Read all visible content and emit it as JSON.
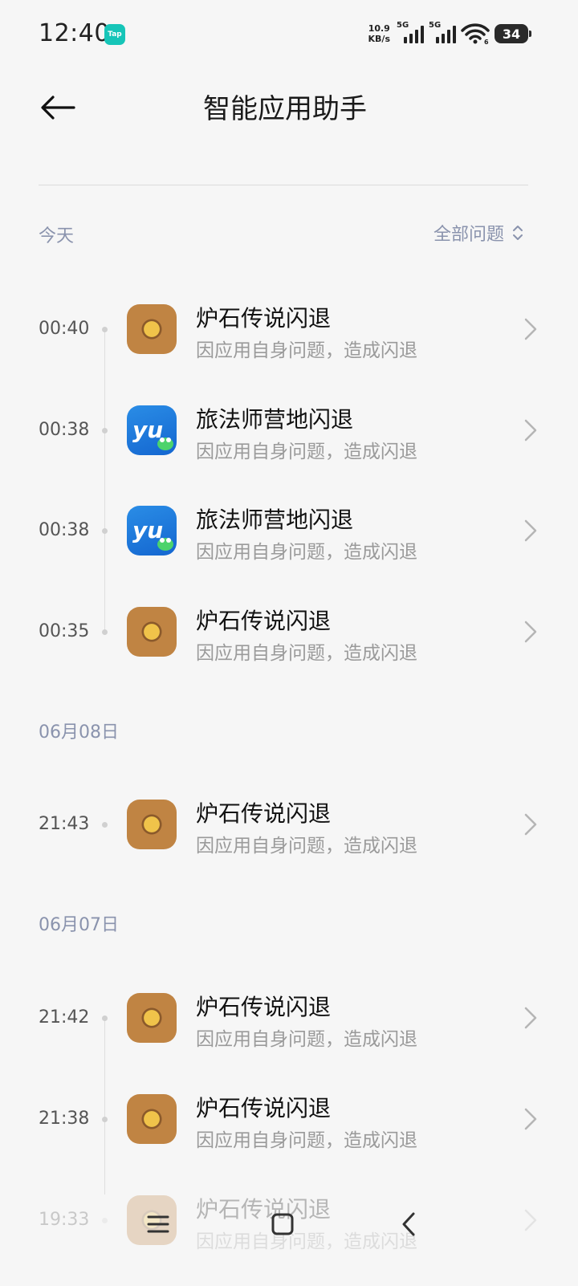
{
  "status_bar": {
    "time": "12:40",
    "tap_badge": "Tap",
    "net_speed_value": "10.9",
    "net_speed_unit": "KB/s",
    "sim1_label": "5G",
    "sim2_label": "5G",
    "wifi_label": "6",
    "battery": "34"
  },
  "header": {
    "title": "智能应用助手"
  },
  "filter": {
    "today_label": "今天",
    "all_issues_label": "全部问题"
  },
  "sections": [
    {
      "label": "今天",
      "items": [
        {
          "time": "00:40",
          "name": "炉石传说闪退",
          "reason": "因应用自身问题，造成闪退",
          "icon": "hearthstone-icon"
        },
        {
          "time": "00:38",
          "name": "旅法师营地闪退",
          "reason": "因应用自身问题，造成闪退",
          "icon": "yu-camp-icon"
        },
        {
          "time": "00:38",
          "name": "旅法师营地闪退",
          "reason": "因应用自身问题，造成闪退",
          "icon": "yu-camp-icon"
        },
        {
          "time": "00:35",
          "name": "炉石传说闪退",
          "reason": "因应用自身问题，造成闪退",
          "icon": "hearthstone-icon"
        }
      ]
    },
    {
      "label": "06月08日",
      "items": [
        {
          "time": "21:43",
          "name": "炉石传说闪退",
          "reason": "因应用自身问题，造成闪退",
          "icon": "hearthstone-icon"
        }
      ]
    },
    {
      "label": "06月07日",
      "items": [
        {
          "time": "21:42",
          "name": "炉石传说闪退",
          "reason": "因应用自身问题，造成闪退",
          "icon": "hearthstone-icon"
        },
        {
          "time": "21:38",
          "name": "炉石传说闪退",
          "reason": "因应用自身问题，造成闪退",
          "icon": "hearthstone-icon"
        },
        {
          "time": "19:33",
          "name": "炉石传说闪退",
          "reason": "因应用自身问题，造成闪退",
          "icon": "hearthstone-icon"
        }
      ]
    }
  ],
  "nav_bar": {
    "icons": [
      "menu-icon",
      "home-square-icon",
      "back-chevron-icon"
    ]
  },
  "colors": {
    "background": "#f6f6f6",
    "section_label": "#8a93ad",
    "tap_badge": "#16c5b8"
  }
}
